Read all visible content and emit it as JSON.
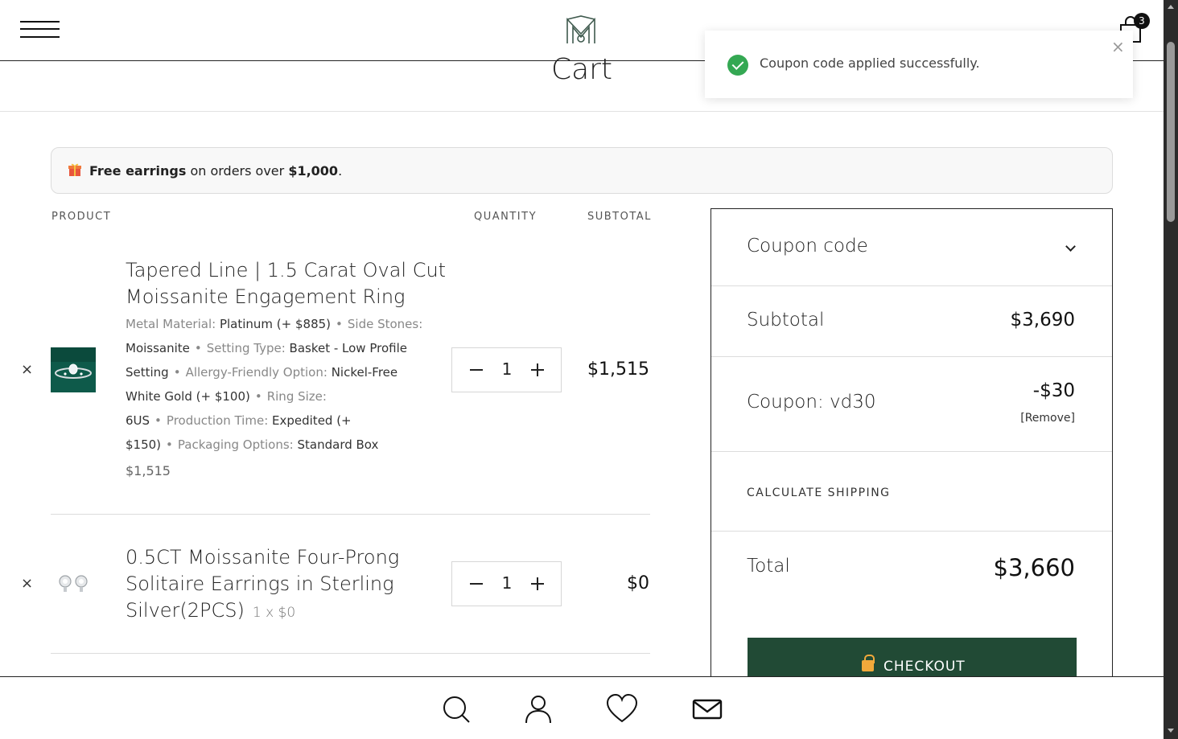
{
  "header": {
    "cart_count": "3",
    "page_title": "Cart"
  },
  "toast": {
    "message": "Coupon code applied successfully.",
    "close_symbol": "×"
  },
  "promo": {
    "bold_lead": "Free earrings",
    "middle": " on orders over ",
    "amount": "$1,000",
    "end": "."
  },
  "columns": {
    "product": "PRODUCT",
    "quantity": "QUANTITY",
    "subtotal": "SUBTOTAL"
  },
  "items": [
    {
      "remove_symbol": "×",
      "name_line1": "Tapered Line | 1.5 Carat Oval Cut",
      "name_line2": "Moissanite Engagement Ring",
      "meta": [
        {
          "label": "Metal Material:",
          "value": "Platinum (+ $885)"
        },
        {
          "label": "Side Stones:",
          "value": "Moissanite"
        },
        {
          "label": "Setting Type:",
          "value": "Basket - Low Profile Setting"
        },
        {
          "label": "Allergy-Friendly Option:",
          "value": "Nickel-Free White Gold (+ $100)"
        },
        {
          "label": "Ring Size:",
          "value": "6US"
        },
        {
          "label": "Production Time:",
          "value": "Expedited (+ $150)"
        },
        {
          "label": "Packaging Options:",
          "value": "Standard Box"
        }
      ],
      "price": "$1,515",
      "quantity": "1",
      "subtotal": "$1,515"
    },
    {
      "remove_symbol": "×",
      "name_line1": "0.5CT Moissanite Four-Prong",
      "name_line2": "Solitaire Earrings in Sterling",
      "name_line3": "Silver(2PCS)",
      "qty_note": "1 x $0",
      "quantity": "1",
      "subtotal": "$0"
    }
  ],
  "summary": {
    "coupon_label": "Coupon code",
    "subtotal_label": "Subtotal",
    "subtotal_value": "$3,690",
    "coupon_applied_label": "Coupon: vd30",
    "coupon_discount": "-$30",
    "coupon_remove": "[Remove]",
    "calc_shipping": "CALCULATE SHIPPING",
    "total_label": "Total",
    "total_value": "$3,660",
    "checkout_label": "CHECKOUT"
  },
  "colors": {
    "checkout_bg": "#214a35",
    "success_green": "#34a853",
    "lock_orange": "#f2a93b"
  },
  "icons": [
    "menu-icon",
    "logo-icon",
    "cart-icon",
    "check-circle-icon",
    "close-icon",
    "gift-icon",
    "search-icon",
    "user-icon",
    "heart-icon",
    "mail-icon",
    "lock-icon",
    "chevron-down-icon"
  ]
}
